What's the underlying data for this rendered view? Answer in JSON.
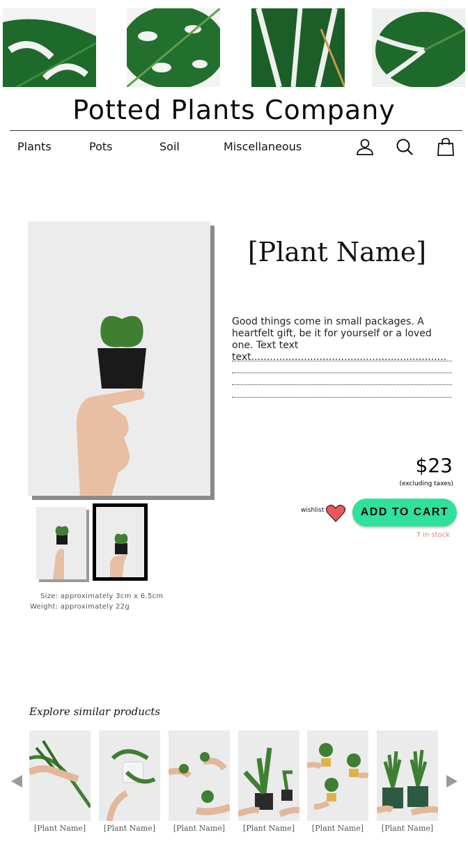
{
  "brand": {
    "name": "Potted Plants Company"
  },
  "nav": {
    "links": [
      "Plants",
      "Pots",
      "Soil",
      "Miscellaneous"
    ],
    "icons": [
      "account-icon",
      "search-icon",
      "shopping-bag-icon"
    ]
  },
  "product": {
    "name": "[Plant Name]",
    "description": "Good things come in small packages. A heartfelt gift, be it for yourself or a loved one. Text text text...............................................................",
    "size": "Size: approximately 3cm x 6.5cm",
    "weight": "Weight: approximately 22g",
    "price": "$23",
    "tax_note": "(excluding taxes)",
    "wishlist_label": "wishlist",
    "add_to_cart": "ADD TO CART",
    "stock": "7 in stock"
  },
  "colors": {
    "accent_button": "#2fe19a",
    "heart": "#f0555a",
    "stock_text": "#e0857a",
    "leaf_green": "#1f6b2a"
  },
  "similar": {
    "heading": "Explore similar products",
    "items": [
      {
        "label": "[Plant Name]"
      },
      {
        "label": "[Plant Name]"
      },
      {
        "label": "[Plant Name]"
      },
      {
        "label": "[Plant Name]"
      },
      {
        "label": "[Plant Name]"
      },
      {
        "label": "[Plant Name]"
      }
    ],
    "prev_icon": "arrow-left-icon",
    "next_icon": "arrow-right-icon"
  }
}
